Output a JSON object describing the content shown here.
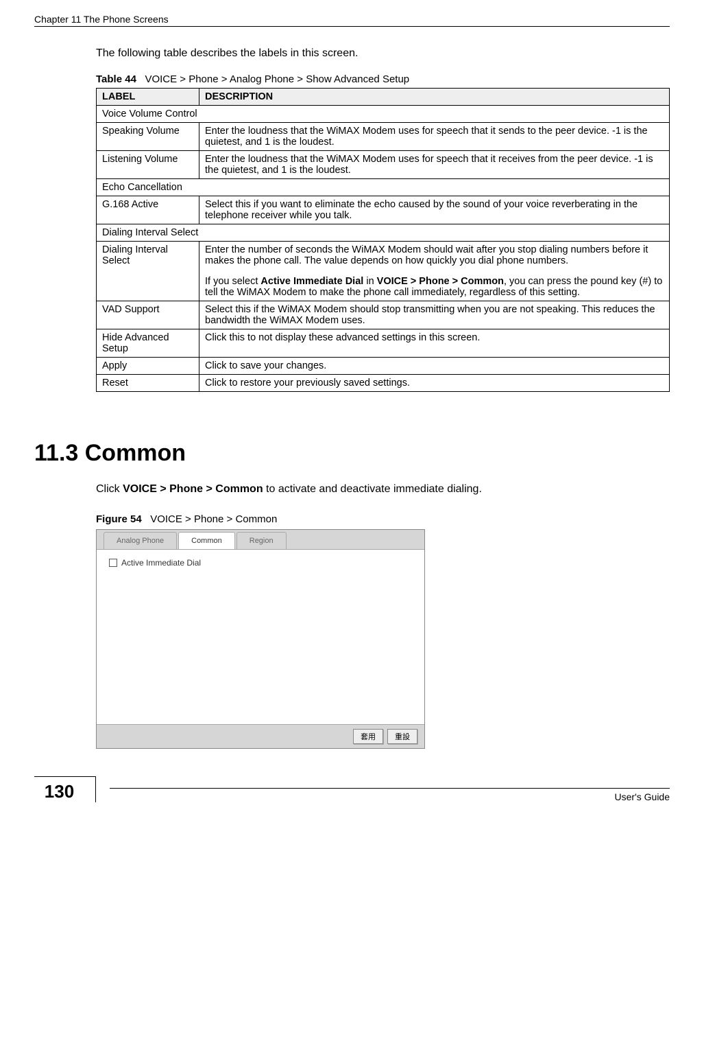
{
  "header": {
    "chapter_title": "Chapter 11 The Phone Screens"
  },
  "intro": "The following table describes the labels in this screen.",
  "table44": {
    "caption_label": "Table 44",
    "caption_text": "VOICE > Phone > Analog Phone > Show Advanced Setup",
    "col_label": "LABEL",
    "col_desc": "DESCRIPTION",
    "rows": {
      "r0": "Voice Volume Control",
      "r1_label": "Speaking Volume",
      "r1_desc": "Enter the loudness that the WiMAX Modem uses for speech that it sends to the peer device. -1 is the quietest, and 1 is the loudest.",
      "r2_label": "Listening Volume",
      "r2_desc": "Enter the loudness that the WiMAX Modem uses for speech that it receives from the peer device. -1 is the quietest, and 1 is the loudest.",
      "r3": "Echo Cancellation",
      "r4_label": "G.168 Active",
      "r4_desc": "Select this if you want to eliminate the echo caused by the sound of your voice reverberating in the telephone receiver while you talk.",
      "r5": "Dialing Interval Select",
      "r6_label": "Dialing Interval Select",
      "r6_desc_p1": "Enter the number of seconds the WiMAX Modem should wait after you stop dialing numbers before it makes the phone call. The value depends on how quickly you dial phone numbers.",
      "r6_desc_p2a": "If you select ",
      "r6_desc_p2b": "Active Immediate Dial",
      "r6_desc_p2c": " in ",
      "r6_desc_p2d": "VOICE > Phone > Common",
      "r6_desc_p2e": ", you can press the pound key (#) to tell the WiMAX Modem to make the phone call immediately, regardless of this setting.",
      "r7_label": "VAD Support",
      "r7_desc": "Select this if the WiMAX Modem should stop transmitting when you are not speaking. This reduces the bandwidth the WiMAX Modem uses.",
      "r8_label": "Hide Advanced Setup",
      "r8_desc": "Click this to not display these advanced settings in this screen.",
      "r9_label": "Apply",
      "r9_desc": "Click to save your changes.",
      "r10_label": "Reset",
      "r10_desc": "Click to restore your previously saved settings."
    }
  },
  "section": {
    "heading": "11.3  Common",
    "text_pre": "Click ",
    "text_bold": "VOICE > Phone > Common",
    "text_post": " to activate and deactivate immediate dialing."
  },
  "figure54": {
    "caption_label": "Figure 54",
    "caption_text": "VOICE > Phone > Common",
    "tabs": {
      "t0": "Analog Phone",
      "t1": "Common",
      "t2": "Region"
    },
    "checkbox_label": "Active Immediate Dial",
    "btn_apply": "套用",
    "btn_reset": "重設"
  },
  "footer": {
    "page_number": "130",
    "guide": "User's Guide"
  }
}
